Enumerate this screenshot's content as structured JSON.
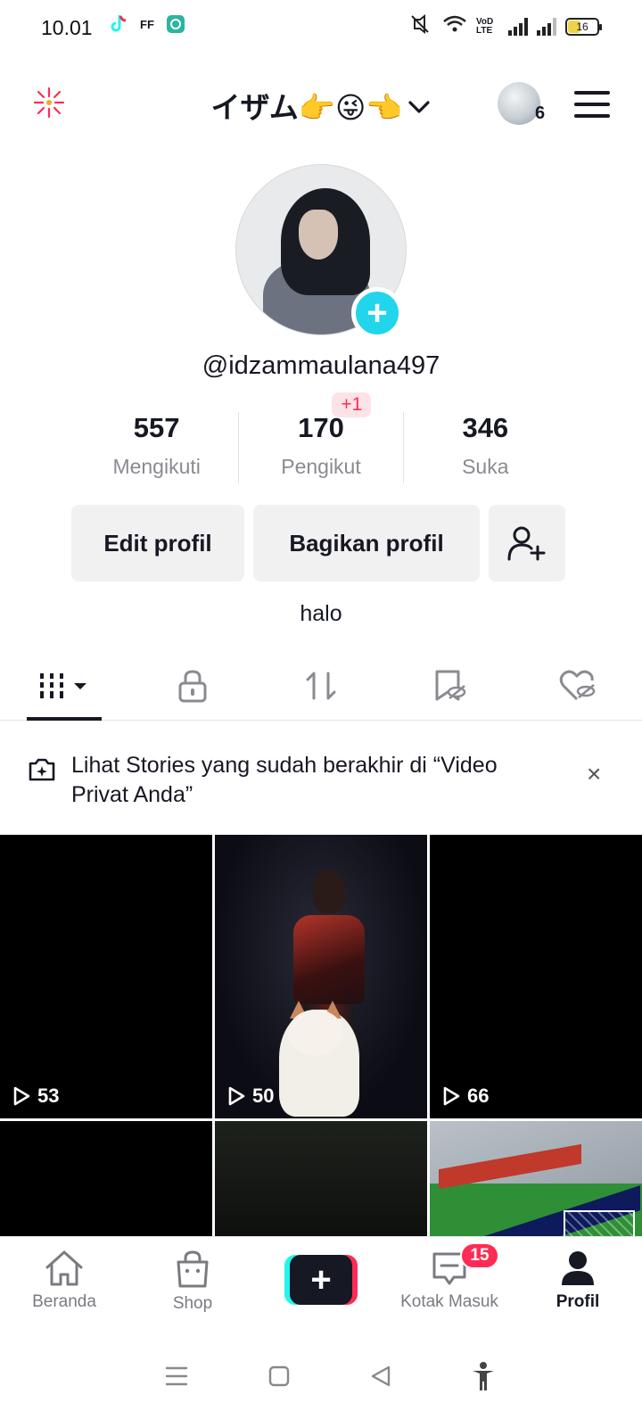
{
  "status_bar": {
    "time": "10.01",
    "app_ff": "FF",
    "net_label": "VoD LTE",
    "battery": "16"
  },
  "header": {
    "title": "イザム👉😜👈",
    "notification_count": "6"
  },
  "profile": {
    "username": "@idzammaulana497",
    "bio": "halo"
  },
  "stats": [
    {
      "value": "557",
      "label": "Mengikuti"
    },
    {
      "value": "170",
      "label": "Pengikut",
      "new": "+1"
    },
    {
      "value": "346",
      "label": "Suka"
    }
  ],
  "actions": {
    "edit": "Edit profil",
    "share": "Bagikan profil"
  },
  "banner": {
    "text": "Lihat Stories yang sudah berakhir di “Video Privat Anda”",
    "close": "×"
  },
  "videos": [
    {
      "views": "53"
    },
    {
      "views": "50"
    },
    {
      "views": "66"
    }
  ],
  "bottom_nav": {
    "home": "Beranda",
    "shop": "Shop",
    "create": "+",
    "inbox": "Kotak Masuk",
    "inbox_badge": "15",
    "profile": "Profil"
  },
  "colors": {
    "accent_red": "#fe2c55",
    "accent_cyan": "#20d5ec",
    "text_primary": "#161823",
    "text_secondary": "#8a8b91"
  }
}
